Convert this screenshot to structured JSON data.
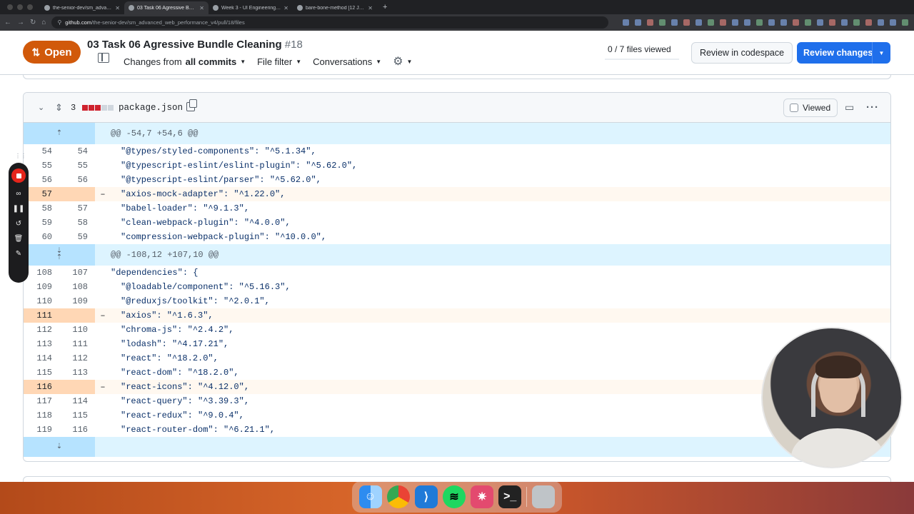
{
  "browser": {
    "tabs": [
      {
        "label": "the-senior-dev/sm_advanced...",
        "active": false
      },
      {
        "label": "03 Task 06 Agressive Bundle",
        "active": true
      },
      {
        "label": "Week 3 - UI Engineering — E",
        "active": false
      },
      {
        "label": "bare-bone-method [12 Jan 2",
        "active": false
      }
    ],
    "new_tab": "+",
    "url_host": "github.com",
    "url_path": "/the-senior-dev/sm_advanced_web_performance_v4/pull/18/files"
  },
  "pr": {
    "state_label": "Open",
    "title": "03 Task 06 Agressive Bundle Cleaning",
    "number": "#18",
    "changes_from_prefix": "Changes from",
    "changes_from_value": "all commits",
    "file_filter": "File filter",
    "conversations": "Conversations",
    "files_viewed": "0 / 7 files viewed",
    "review_codespace": "Review in codespace",
    "review_changes": "Review changes"
  },
  "file": {
    "changed_count": "3",
    "name": "package.json",
    "viewed_label": "Viewed",
    "diff_bar": [
      "del",
      "del",
      "del",
      "neu",
      "neu"
    ]
  },
  "diff": {
    "hunk1": "@@ -54,7 +54,6 @@",
    "hunk2": "@@ -108,12 +107,10 @@",
    "rows1": [
      {
        "old": "54",
        "new": "54",
        "sign": "",
        "code": "\"@types/styled-components\": \"^5.1.34\",",
        "type": "ctx"
      },
      {
        "old": "55",
        "new": "55",
        "sign": "",
        "code": "\"@typescript-eslint/eslint-plugin\": \"^5.62.0\",",
        "type": "ctx"
      },
      {
        "old": "56",
        "new": "56",
        "sign": "",
        "code": "\"@typescript-eslint/parser\": \"^5.62.0\",",
        "type": "ctx"
      },
      {
        "old": "57",
        "new": "",
        "sign": "–",
        "code": "\"axios-mock-adapter\": \"^1.22.0\",",
        "type": "del"
      },
      {
        "old": "58",
        "new": "57",
        "sign": "",
        "code": "\"babel-loader\": \"^9.1.3\",",
        "type": "ctx"
      },
      {
        "old": "59",
        "new": "58",
        "sign": "",
        "code": "\"clean-webpack-plugin\": \"^4.0.0\",",
        "type": "ctx"
      },
      {
        "old": "60",
        "new": "59",
        "sign": "",
        "code": "\"compression-webpack-plugin\": \"^10.0.0\",",
        "type": "ctx"
      }
    ],
    "rows2": [
      {
        "old": "108",
        "new": "107",
        "sign": "",
        "code": "\"dependencies\": {",
        "type": "ctx",
        "indent": 1
      },
      {
        "old": "109",
        "new": "108",
        "sign": "",
        "code": "\"@loadable/component\": \"^5.16.3\",",
        "type": "ctx"
      },
      {
        "old": "110",
        "new": "109",
        "sign": "",
        "code": "\"@reduxjs/toolkit\": \"^2.0.1\",",
        "type": "ctx"
      },
      {
        "old": "111",
        "new": "",
        "sign": "–",
        "code": "\"axios\": \"^1.6.3\",",
        "type": "del"
      },
      {
        "old": "112",
        "new": "110",
        "sign": "",
        "code": "\"chroma-js\": \"^2.4.2\",",
        "type": "ctx"
      },
      {
        "old": "113",
        "new": "111",
        "sign": "",
        "code": "\"lodash\": \"^4.17.21\",",
        "type": "ctx"
      },
      {
        "old": "114",
        "new": "112",
        "sign": "",
        "code": "\"react\": \"^18.2.0\",",
        "type": "ctx"
      },
      {
        "old": "115",
        "new": "113",
        "sign": "",
        "code": "\"react-dom\": \"^18.2.0\",",
        "type": "ctx"
      },
      {
        "old": "116",
        "new": "",
        "sign": "–",
        "code": "\"react-icons\": \"^4.12.0\",",
        "type": "del"
      },
      {
        "old": "117",
        "new": "114",
        "sign": "",
        "code": "\"react-query\": \"^3.39.3\",",
        "type": "ctx"
      },
      {
        "old": "118",
        "new": "115",
        "sign": "",
        "code": "\"react-redux\": \"^9.0.4\",",
        "type": "ctx"
      },
      {
        "old": "119",
        "new": "116",
        "sign": "",
        "code": "\"react-router-dom\": \"^6.21.1\",",
        "type": "ctx"
      }
    ]
  },
  "dock": {
    "apps": [
      "finder",
      "chrome",
      "vscode",
      "spotify",
      "loom",
      "terminal",
      "trash"
    ]
  },
  "colors": {
    "open_badge": "#d1590a",
    "review_button": "#1f6feb",
    "hunk_bg": "#ddf4ff",
    "deleted_line_number_bg": "#ffd7b5"
  }
}
